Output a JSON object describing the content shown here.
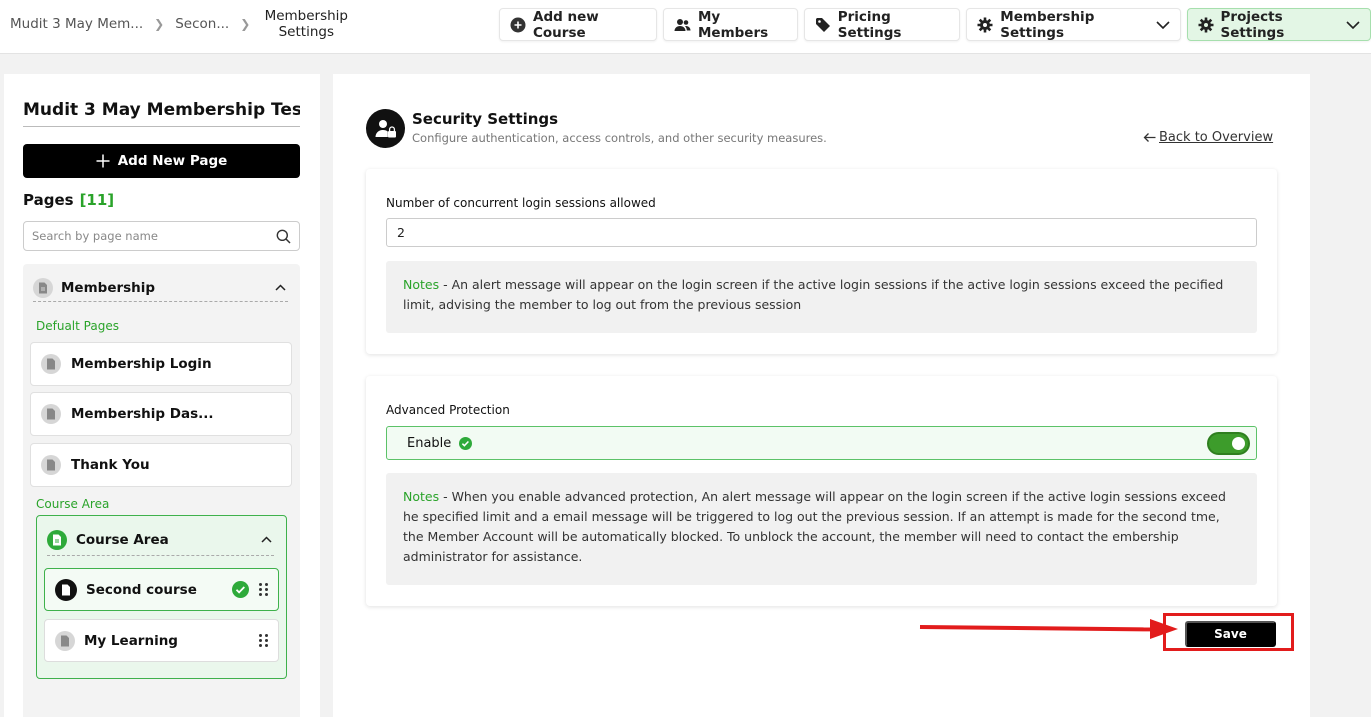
{
  "breadcrumb": {
    "items": [
      "Mudit 3 May Mem...",
      "Secon..."
    ],
    "current_line1": "Membership",
    "current_line2": "Settings"
  },
  "nav": {
    "add_course": "Add new Course",
    "my_members": "My Members",
    "pricing": "Pricing Settings",
    "membership_settings": "Membership Settings",
    "projects_settings": "Projects Settings"
  },
  "sidebar": {
    "title": "Mudit 3 May Membership Tes...",
    "add_page": "Add New Page",
    "pages_label": "Pages",
    "pages_count": "[11]",
    "search_placeholder": "Search by page name",
    "group_title": "Membership",
    "default_label": "Defualt Pages",
    "default_pages": [
      "Membership Login",
      "Membership Das...",
      "Thank You"
    ],
    "course_area_label": "Course Area",
    "course_area_title": "Course Area",
    "course_items": [
      "Second course",
      "My Learning"
    ]
  },
  "main": {
    "title": "Security Settings",
    "subtitle": "Configure authentication, access controls, and other security measures.",
    "back_link": "Back to Overview",
    "sessions_label": "Number of concurrent login sessions allowed",
    "sessions_value": "2",
    "notes_label": "Notes",
    "notes1": " - An alert message will appear on the login screen if the active login sessions if the active login sessions exceed the pecified limit, advising the member to log out from the previous session",
    "adv_label": "Advanced Protection",
    "enable_label": "Enable",
    "advanced_enabled": true,
    "notes2": " - When you enable advanced protection, An alert message will appear on the login screen if the active login sessions exceed he specified limit and a email message will be triggered to log out the previous session. If an attempt is made for the second tme, the Member Account will be automatically blocked. To unblock the account, the member will need to contact the embership administrator for assistance.",
    "save": "Save"
  },
  "colors": {
    "accent_green": "#2aa32a",
    "annotation_red": "#e21c1c"
  }
}
